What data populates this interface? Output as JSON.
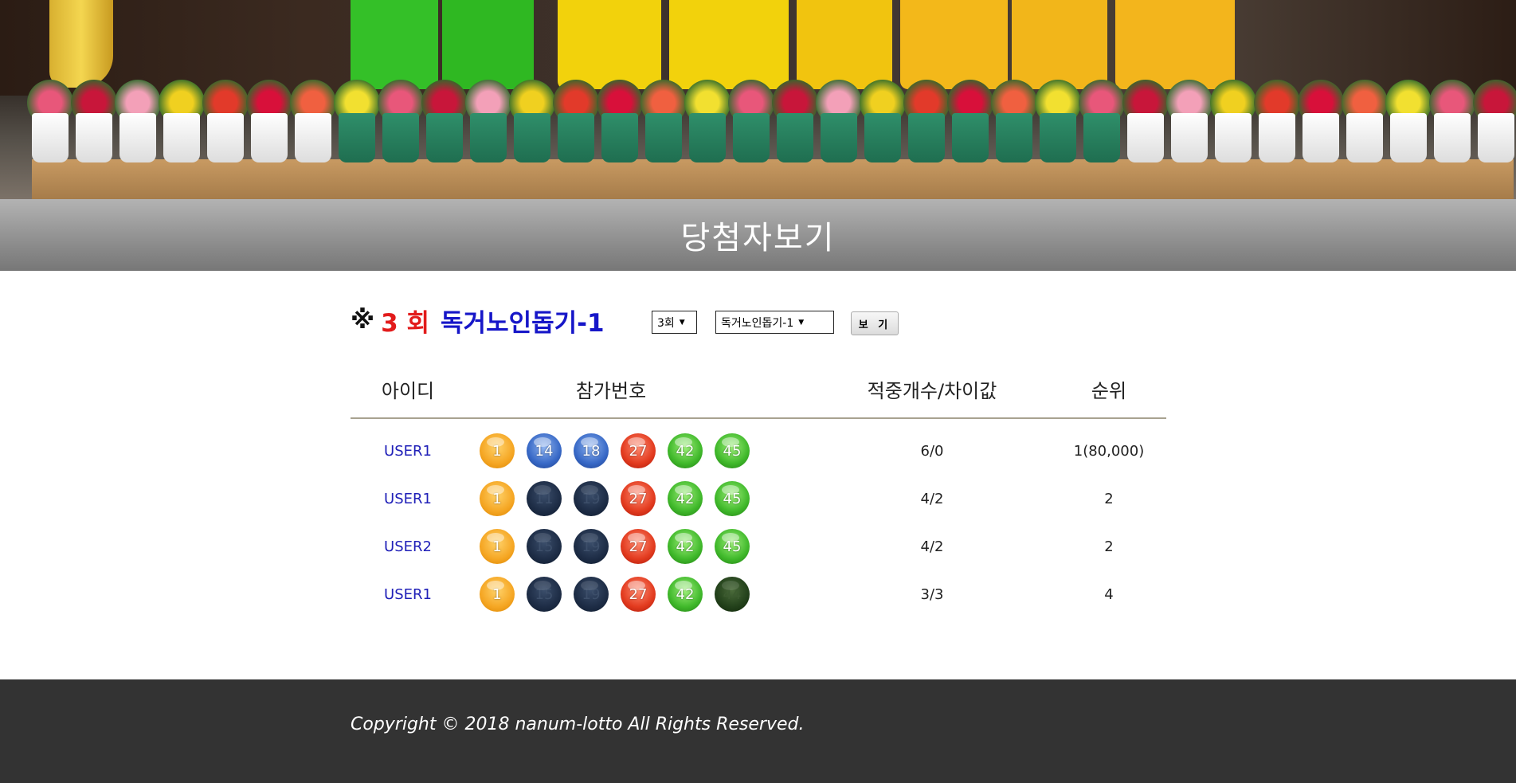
{
  "page": {
    "title": "당첨자보기"
  },
  "headline": {
    "mark": "※",
    "round": "3 회",
    "game": "독거노인돕기-1"
  },
  "filters": {
    "round_select": "3회",
    "game_select": "독거노인돕기-1",
    "view_button": "보 기"
  },
  "table": {
    "headers": [
      "아이디",
      "참가번호",
      "적중개수/차이값",
      "순위"
    ],
    "rows": [
      {
        "user": "USER1",
        "numbers": [
          {
            "n": "1",
            "color": "yellow"
          },
          {
            "n": "14",
            "color": "blue"
          },
          {
            "n": "18",
            "color": "blue"
          },
          {
            "n": "27",
            "color": "red"
          },
          {
            "n": "42",
            "color": "green"
          },
          {
            "n": "45",
            "color": "green"
          }
        ],
        "hits": "6/0",
        "rank": "1(80,000)"
      },
      {
        "user": "USER1",
        "numbers": [
          {
            "n": "1",
            "color": "yellow"
          },
          {
            "n": "11",
            "color": "navy"
          },
          {
            "n": "19",
            "color": "navy"
          },
          {
            "n": "27",
            "color": "red"
          },
          {
            "n": "42",
            "color": "green"
          },
          {
            "n": "45",
            "color": "green"
          }
        ],
        "hits": "4/2",
        "rank": "2"
      },
      {
        "user": "USER2",
        "numbers": [
          {
            "n": "1",
            "color": "yellow"
          },
          {
            "n": "15",
            "color": "navy"
          },
          {
            "n": "19",
            "color": "navy"
          },
          {
            "n": "27",
            "color": "red"
          },
          {
            "n": "42",
            "color": "green"
          },
          {
            "n": "45",
            "color": "green"
          }
        ],
        "hits": "4/2",
        "rank": "2"
      },
      {
        "user": "USER1",
        "numbers": [
          {
            "n": "1",
            "color": "yellow"
          },
          {
            "n": "15",
            "color": "navy"
          },
          {
            "n": "19",
            "color": "navy"
          },
          {
            "n": "27",
            "color": "red"
          },
          {
            "n": "42",
            "color": "green"
          },
          {
            "n": "44",
            "color": "dkgreen"
          }
        ],
        "hits": "3/3",
        "rank": "4"
      }
    ]
  },
  "footer": {
    "copyright": "Copyright © 2018 nanum-lotto All Rights Reserved."
  },
  "colors": {
    "round_red": "#e21b1b",
    "game_blue": "#1616c8",
    "user_link": "#2020b8",
    "footer_bg": "#333333"
  }
}
